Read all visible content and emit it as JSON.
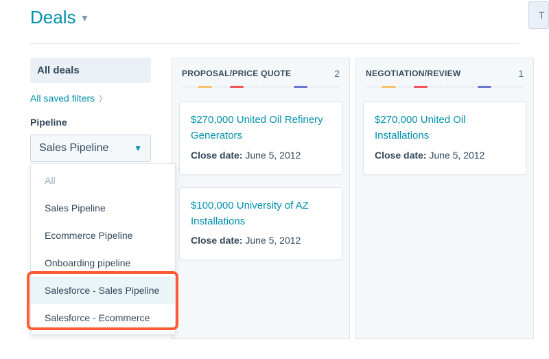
{
  "header": {
    "title": "Deals",
    "top_button": "T"
  },
  "sidebar": {
    "all_deals": "All deals",
    "saved_filters": "All saved filters",
    "pipeline_label": "Pipeline",
    "select_value": "Sales Pipeline",
    "options": [
      {
        "label": "All",
        "cls": "all"
      },
      {
        "label": "Sales Pipeline",
        "cls": ""
      },
      {
        "label": "Ecommerce Pipeline",
        "cls": ""
      },
      {
        "label": "Onboarding pipeline",
        "cls": ""
      },
      {
        "label": "Salesforce - Sales Pipeline",
        "cls": "hl"
      },
      {
        "label": "Salesforce - Ecommerce",
        "cls": ""
      }
    ]
  },
  "columns": [
    {
      "title": "PROPOSAL/PRICE QUOTE",
      "count": "2",
      "stripe": [
        "",
        "c1",
        "",
        "c2",
        "",
        "",
        "",
        "c3",
        "",
        ""
      ],
      "cards": [
        {
          "title": "$270,000 United Oil Refinery Generators",
          "close_label": "Close date:",
          "close_value": "June 5, 2012"
        },
        {
          "title": "$100,000 University of AZ Installations",
          "close_label": "Close date:",
          "close_value": "June 5, 2012"
        }
      ]
    },
    {
      "title": "NEGOTIATION/REVIEW",
      "count": "1",
      "stripe": [
        "",
        "c1",
        "",
        "c2",
        "",
        "",
        "",
        "c3",
        "",
        ""
      ],
      "cards": [
        {
          "title": "$270,000 United Oil Installations",
          "close_label": "Close date:",
          "close_value": "June 5, 2012"
        }
      ]
    }
  ]
}
